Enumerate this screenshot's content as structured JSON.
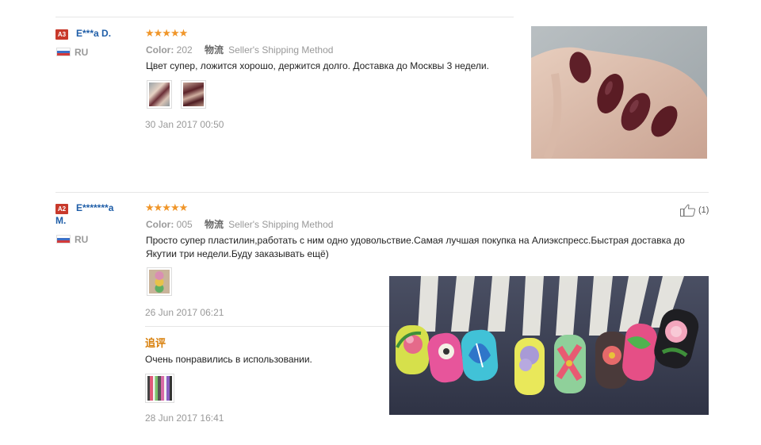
{
  "reviews": [
    {
      "badge": "A3",
      "name": "E***a D.",
      "country": "RU",
      "stars": "★★★★★",
      "color_label": "Color:",
      "color_value": "202",
      "shipping_cn": "物流",
      "shipping": "Seller's Shipping Method",
      "text": "Цвет супер, ложится хорошо, держится долго. Доставка до Москвы 3 недели.",
      "date": "30 Jan 2017 00:50"
    },
    {
      "badge": "A2",
      "name_line1": "E*******a",
      "name_line2": "M.",
      "country": "RU",
      "stars": "★★★★★",
      "color_label": "Color:",
      "color_value": "005",
      "shipping_cn": "物流",
      "shipping": "Seller's Shipping Method",
      "text": "Просто супер пластилин,работать с ним одно удовольствие.Самая лучшая покупка на Алиэкспресс.Быстрая доставка до Якутии три недели.Буду заказывать ещё)",
      "date": "26 Jun 2017 06:21",
      "likes": "(1)",
      "followup_label": "追评",
      "followup_text": "Очень понравились в использовании.",
      "followup_date": "28 Jun 2017 16:41"
    }
  ]
}
